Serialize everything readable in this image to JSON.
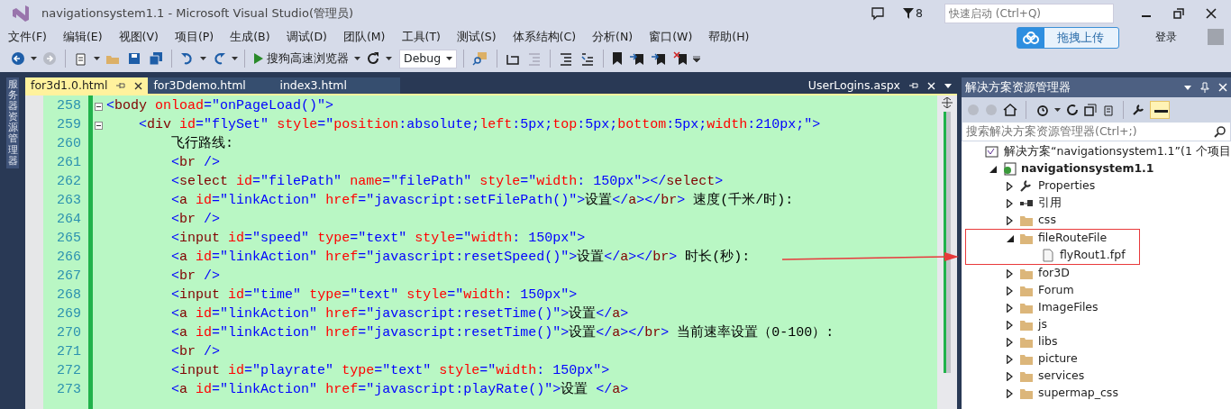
{
  "window": {
    "title": "navigationsystem1.1 - Microsoft Visual Studio(管理员)",
    "notification_count": "8",
    "quick_launch": {
      "placeholder": "快速启动 (Ctrl+Q)"
    },
    "sign_in": "登录"
  },
  "upload_popup": {
    "label": "拖拽上传"
  },
  "menu": [
    "文件(F)",
    "编辑(E)",
    "视图(V)",
    "项目(P)",
    "生成(B)",
    "调试(D)",
    "团队(M)",
    "工具(T)",
    "测试(S)",
    "体系结构(C)",
    "分析(N)",
    "窗口(W)",
    "帮助(H)"
  ],
  "toolbar": {
    "browser": "搜狗高速浏览器",
    "configuration": "Debug"
  },
  "side_tab": "服务器资源管理器",
  "editor_tabs": [
    {
      "label": "for3d1.0.html",
      "selected": true
    },
    {
      "label": "for3Ddemo.html",
      "selected": false
    },
    {
      "label": "index3.html",
      "selected": false
    }
  ],
  "overflow_tab": "UserLogins.aspx",
  "code_lines": [
    {
      "number": "258",
      "fold": true,
      "text": "<body onload=\"onPageLoad()\">"
    },
    {
      "number": "259",
      "fold": true,
      "text": "    <div id=\"flySet\" style=\"position:absolute;left:5px;top:5px;bottom:5px;width:210px;\">"
    },
    {
      "number": "260",
      "fold": false,
      "text": "        飞行路线:"
    },
    {
      "number": "261",
      "fold": false,
      "text": "        <br />"
    },
    {
      "number": "262",
      "fold": false,
      "text": "        <select id=\"filePath\" name=\"filePath\" style=\"width: 150px\"></select>"
    },
    {
      "number": "263",
      "fold": false,
      "text": "        <a id=\"linkAction\" href=\"javascript:setFilePath()\">设置</a></br> 速度(千米/时):"
    },
    {
      "number": "264",
      "fold": false,
      "text": "        <br />"
    },
    {
      "number": "265",
      "fold": false,
      "text": "        <input id=\"speed\" type=\"text\" style=\"width: 150px\">"
    },
    {
      "number": "266",
      "fold": false,
      "text": "        <a id=\"linkAction\" href=\"javascript:resetSpeed()\">设置</a></br> 时长(秒):"
    },
    {
      "number": "267",
      "fold": false,
      "text": "        <br />"
    },
    {
      "number": "268",
      "fold": false,
      "text": "        <input id=\"time\" type=\"text\" style=\"width: 150px\">"
    },
    {
      "number": "269",
      "fold": false,
      "text": "        <a id=\"linkAction\" href=\"javascript:resetTime()\">设置</a>"
    },
    {
      "number": "270",
      "fold": false,
      "text": "        <a id=\"linkAction\" href=\"javascript:resetTime()\">设置</a></br> 当前速率设置（0-100）:"
    },
    {
      "number": "271",
      "fold": false,
      "text": "        <br />"
    },
    {
      "number": "272",
      "fold": false,
      "text": "        <input id=\"playrate\" type=\"text\" style=\"width: 150px\">"
    },
    {
      "number": "273",
      "fold": false,
      "text": "        <a id=\"linkAction\" href=\"javascript:playRate()\">设置 </a>"
    }
  ],
  "solution_explorer": {
    "title": "解决方案资源管理器",
    "search": {
      "placeholder": "搜索解决方案资源管理器(Ctrl+;)"
    },
    "tree": [
      {
        "label": "解决方案“navigationsystem1.1”(1 个项目",
        "kind": "solution",
        "children": [
          {
            "label": "navigationsystem1.1",
            "kind": "project",
            "expanded": true,
            "children": [
              {
                "label": "Properties",
                "kind": "properties",
                "expanded": false,
                "highlighted": false
              },
              {
                "label": "引用",
                "kind": "references",
                "expanded": false,
                "highlighted": false
              },
              {
                "label": "css",
                "kind": "folder",
                "expanded": false,
                "highlighted": false
              },
              {
                "label": "fileRouteFile",
                "kind": "folder",
                "expanded": true,
                "highlighted": true,
                "children": [
                  {
                    "label": "flyRout1.fpf",
                    "kind": "file"
                  }
                ]
              },
              {
                "label": "for3D",
                "kind": "folder",
                "expanded": false,
                "highlighted": false
              },
              {
                "label": "Forum",
                "kind": "folder",
                "expanded": false,
                "highlighted": false
              },
              {
                "label": "ImageFiles",
                "kind": "folder",
                "expanded": false,
                "highlighted": false
              },
              {
                "label": "js",
                "kind": "folder",
                "expanded": false,
                "highlighted": false
              },
              {
                "label": "libs",
                "kind": "folder",
                "expanded": false,
                "highlighted": false
              },
              {
                "label": "picture",
                "kind": "folder",
                "expanded": false,
                "highlighted": false
              },
              {
                "label": "services",
                "kind": "folder",
                "expanded": false,
                "highlighted": false
              },
              {
                "label": "supermap_css",
                "kind": "folder",
                "expanded": false,
                "highlighted": false
              }
            ]
          }
        ]
      }
    ]
  }
}
